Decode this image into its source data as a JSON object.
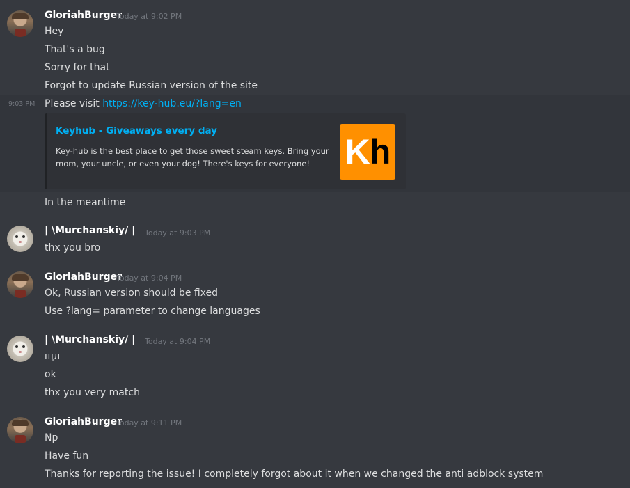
{
  "messages": {
    "g1": {
      "author": "GloriahBurger",
      "timestamp": "Today at 9:02 PM",
      "lines": [
        "Hey",
        "That's a bug",
        "Sorry for that",
        "Forgot to update Russian version of the site"
      ]
    },
    "g1_cont": {
      "hover_time": "9:03 PM",
      "text": "Please visit ",
      "link": "https://key-hub.eu/?lang=en",
      "after": "In the meantime"
    },
    "embed": {
      "title": "Keyhub - Giveaways every day",
      "description": "Key-hub is the best place to get those sweet steam keys. Bring your mom, your uncle, or even your dog! There's keys for everyone!",
      "thumb_k": "K",
      "thumb_h": "h",
      "thumb_color": "#ff9000"
    },
    "m1": {
      "author": "| \\Murchanskiy/ |",
      "timestamp": "Today at 9:03 PM",
      "lines": [
        "thx you bro"
      ]
    },
    "g2": {
      "author": "GloriahBurger",
      "timestamp": "Today at 9:04 PM",
      "lines": [
        "Ok, Russian version should be fixed",
        "Use ?lang= parameter to change languages"
      ]
    },
    "m2": {
      "author": "| \\Murchanskiy/ |",
      "timestamp": "Today at 9:04 PM",
      "lines": [
        "щл",
        "ok",
        "thx you very match"
      ]
    },
    "g3": {
      "author": "GloriahBurger",
      "timestamp": "Today at 9:11 PM",
      "lines": [
        "Np",
        "Have fun",
        "Thanks for reporting the issue! I completely forgot about it when we changed the anti adblock system"
      ]
    }
  },
  "colors": {
    "background": "#36393f",
    "link": "#00b0f4",
    "username": "#ffffff",
    "timestamp": "#72767d"
  }
}
